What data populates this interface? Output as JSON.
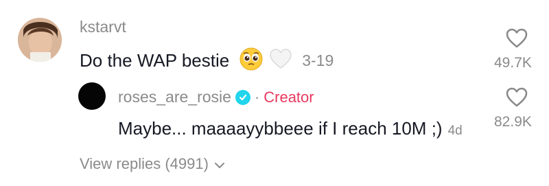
{
  "comment": {
    "username": "kstarvt",
    "text": "Do the WAP bestie",
    "date": "3-19",
    "likes": "49.7K",
    "icons": [
      "pleading-face-emoji",
      "white-heart-emoji",
      "heart-outline-icon"
    ]
  },
  "reply": {
    "username": "roses_are_rosie",
    "separator": "·",
    "badge": "Creator",
    "text": "Maybe... maaaayybbeee if I reach 10M ;)",
    "age": "4d",
    "likes": "82.9K",
    "icons": [
      "verified-badge-icon",
      "heart-outline-icon"
    ]
  },
  "view_replies": {
    "label": "View replies (4991)",
    "icon": "chevron-down-icon"
  }
}
